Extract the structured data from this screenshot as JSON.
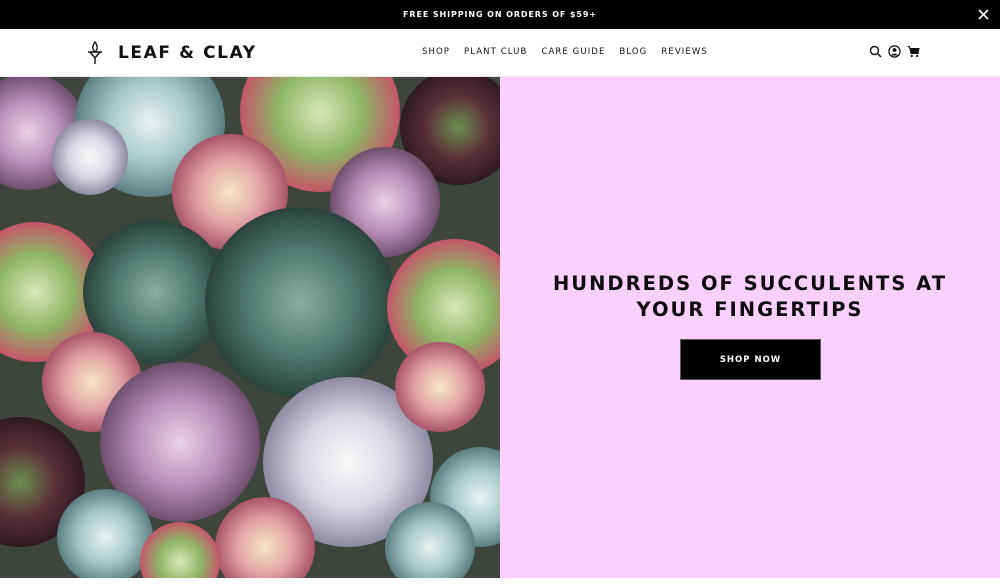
{
  "announcement": {
    "text": "FREE SHIPPING ON ORDERS OF $59+",
    "close_icon": "close-icon"
  },
  "header": {
    "brand": "LEAF & CLAY",
    "logo_icon": "plant-sprout-icon",
    "nav": [
      "SHOP",
      "PLANT CLUB",
      "CARE GUIDE",
      "BLOG",
      "REVIEWS"
    ],
    "utility_icons": [
      "search-icon",
      "account-icon",
      "cart-icon"
    ]
  },
  "hero": {
    "image": "succulent-arrangement-photo",
    "headline": "HUNDREDS OF SUCCULENTS AT YOUR FINGERTIPS",
    "cta_label": "SHOP NOW",
    "panel_color": "#fcd0fc",
    "button_color": "#000000"
  }
}
